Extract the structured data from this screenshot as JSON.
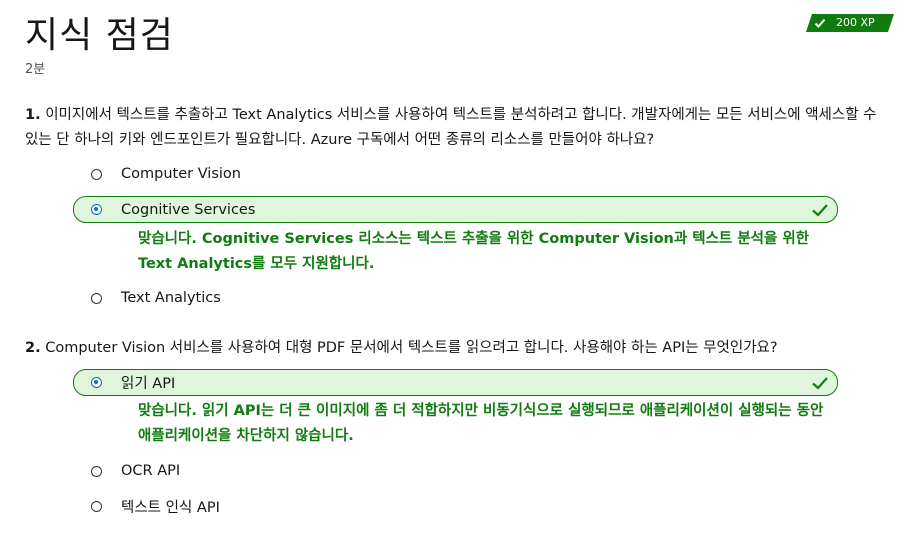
{
  "header": {
    "title": "지식 점검",
    "duration": "2분",
    "xp_badge": "200 XP"
  },
  "questions": [
    {
      "number": "1.",
      "text": "이미지에서 텍스트를 추출하고 Text Analytics 서비스를 사용하여 텍스트를 분석하려고 합니다. 개발자에게는 모든 서비스에 액세스할 수 있는 단 하나의 키와 엔드포인트가 필요합니다. Azure 구독에서 어떤 종류의 리소스를 만들어야 하나요?",
      "options": [
        {
          "label": "Computer Vision",
          "selected": false,
          "correct": false
        },
        {
          "label": "Cognitive Services",
          "selected": true,
          "correct": true
        },
        {
          "label": "Text Analytics",
          "selected": false,
          "correct": false
        }
      ],
      "feedback": "맞습니다. Cognitive Services 리소스는 텍스트 추출을 위한 Computer Vision과 텍스트 분석을 위한 Text Analytics를 모두 지원합니다."
    },
    {
      "number": "2.",
      "text": "Computer Vision 서비스를 사용하여 대형 PDF 문서에서 텍스트를 읽으려고 합니다. 사용해야 하는 API는 무엇인가요?",
      "options": [
        {
          "label": "읽기 API",
          "selected": true,
          "correct": true
        },
        {
          "label": "OCR API",
          "selected": false,
          "correct": false
        },
        {
          "label": "텍스트 인식 API",
          "selected": false,
          "correct": false
        }
      ],
      "feedback": "맞습니다. 읽기 API는 더 큰 이미지에 좀 더 적합하지만 비동기식으로 실행되므로 애플리케이션이 실행되는 동안 애플리케이션을 차단하지 않습니다."
    }
  ],
  "colors": {
    "success": "#107c10",
    "success_bg": "#dff6dd",
    "radio_accent": "#0f6cbd"
  },
  "icons": {
    "badge": "checkmark-icon",
    "correct": "checkmark-icon",
    "radio": "radio-button-icon"
  }
}
